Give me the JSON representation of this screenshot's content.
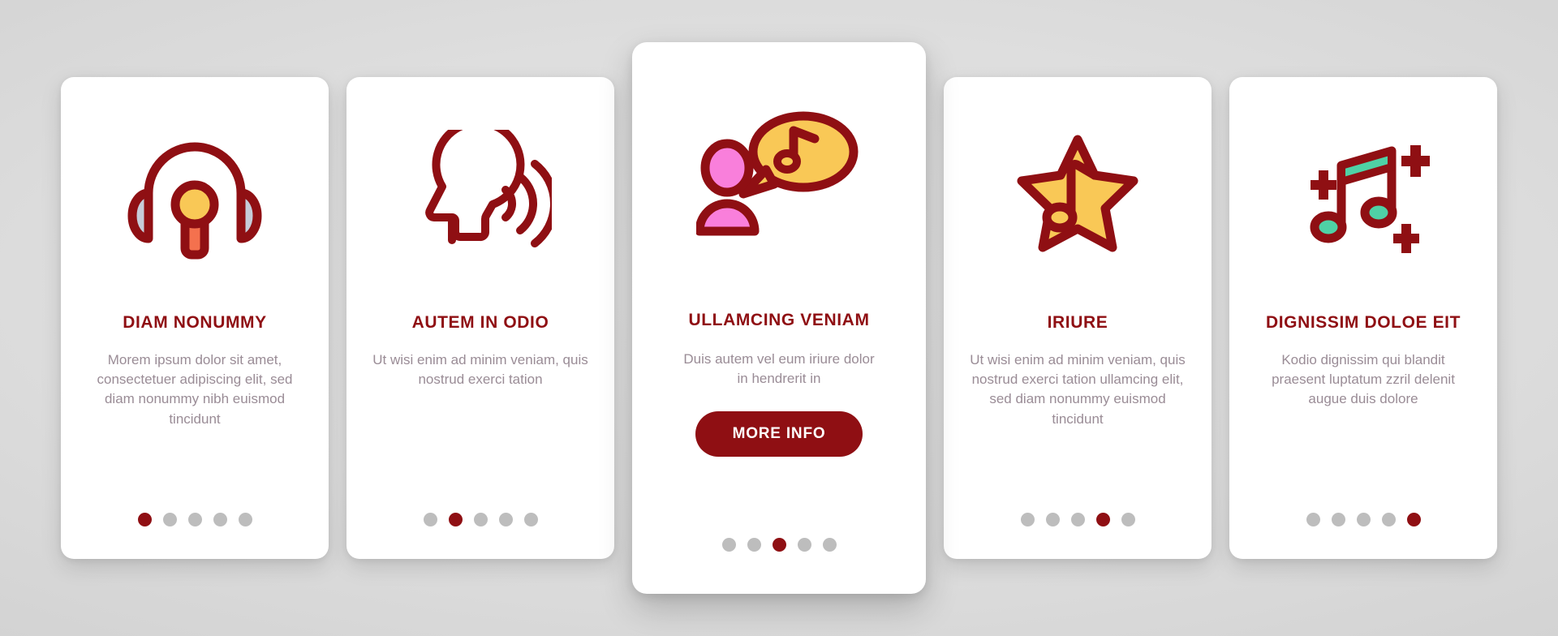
{
  "theme": {
    "accent": "#8f0f13",
    "body_text": "#9a8c96",
    "dot_inactive": "#bdbdbd",
    "card_bg": "#ffffff",
    "background": "#d8d8d8",
    "icon_yellow": "#f9c856",
    "icon_pink": "#f97fdb",
    "icon_orange": "#f4714e",
    "icon_grey_blue": "#c6ccd9",
    "icon_teal": "#4fd1a5"
  },
  "cards": [
    {
      "icon": "headphones-microphone-icon",
      "title": "DIAM NONUMMY",
      "body": "Morem ipsum dolor sit amet, consectetuer adipiscing elit, sed diam nonummy nibh euismod tincidunt",
      "dots_total": 5,
      "dot_active": 1,
      "featured": false
    },
    {
      "icon": "speaking-head-icon",
      "title": "AUTEM IN ODIO",
      "body": "Ut wisi enim ad minim veniam, quis nostrud exerci tation",
      "dots_total": 5,
      "dot_active": 2,
      "featured": false
    },
    {
      "icon": "person-music-speech-bubble-icon",
      "title": "ULLAMCING VENIAM",
      "body": "Duis autem vel eum iriure dolor in hendrerit in",
      "button_label": "MORE INFO",
      "dots_total": 5,
      "dot_active": 3,
      "featured": true
    },
    {
      "icon": "star-music-note-icon",
      "title": "IRIURE",
      "body": "Ut wisi enim ad minim veniam, quis nostrud exerci tation ullamcing elit, sed diam nonummy euismod tincidunt",
      "dots_total": 5,
      "dot_active": 4,
      "featured": false
    },
    {
      "icon": "music-notes-sparkle-icon",
      "title": "DIGNISSIM DOLOE EIT",
      "body": "Kodio dignissim qui blandit praesent luptatum zzril delenit augue duis dolore",
      "dots_total": 5,
      "dot_active": 5,
      "featured": false
    }
  ]
}
